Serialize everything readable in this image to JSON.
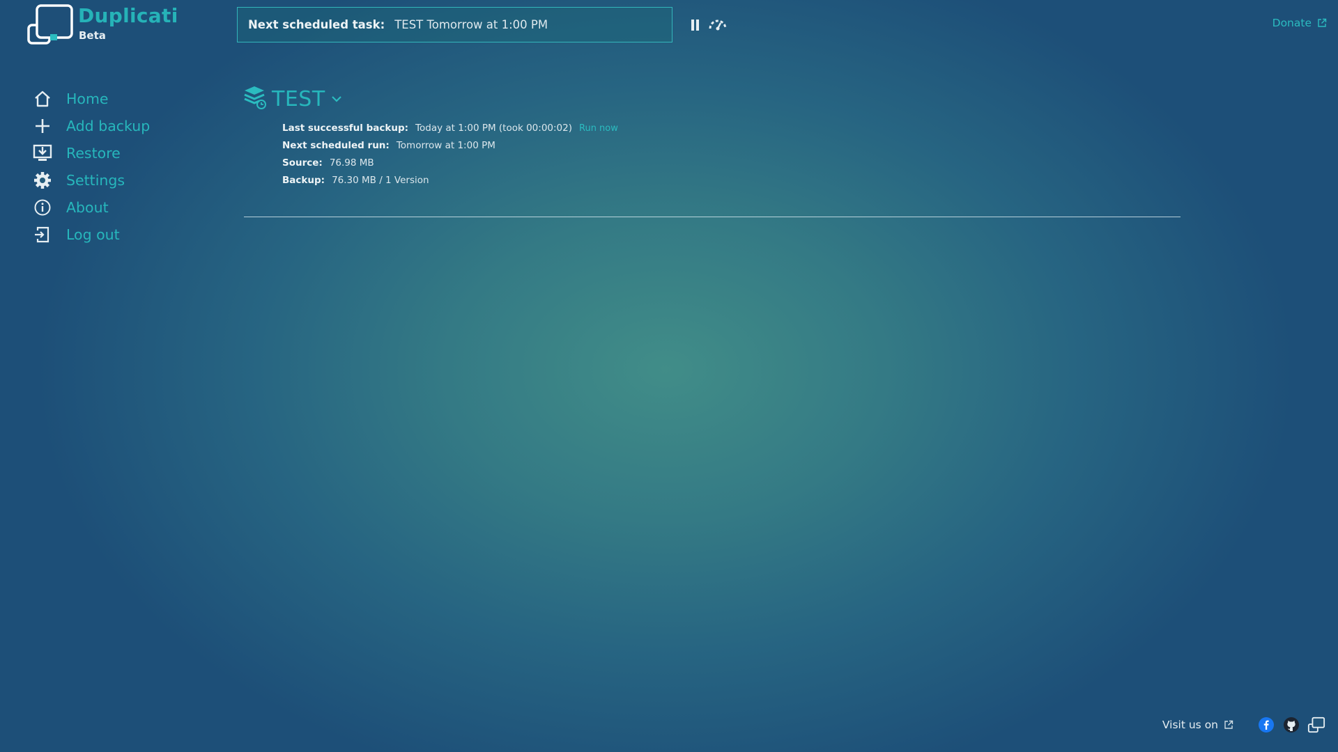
{
  "app": {
    "name": "Duplicati",
    "edition": "Beta"
  },
  "status": {
    "label": "Next scheduled task:",
    "value": "TEST Tomorrow at 1:00 PM"
  },
  "header": {
    "donate_label": "Donate"
  },
  "sidebar": {
    "items": [
      {
        "label": "Home",
        "icon": "home-icon"
      },
      {
        "label": "Add backup",
        "icon": "plus-icon"
      },
      {
        "label": "Restore",
        "icon": "restore-icon"
      },
      {
        "label": "Settings",
        "icon": "gear-icon"
      },
      {
        "label": "About",
        "icon": "info-icon"
      },
      {
        "label": "Log out",
        "icon": "logout-icon"
      }
    ]
  },
  "backup": {
    "name": "TEST",
    "last_backup_label": "Last successful backup:",
    "last_backup_value": "Today at 1:00 PM (took 00:00:02)",
    "run_now_label": "Run now",
    "next_run_label": "Next scheduled run:",
    "next_run_value": "Tomorrow at 1:00 PM",
    "source_label": "Source:",
    "source_value": "76.98 MB",
    "backup_label": "Backup:",
    "backup_value": "76.30 MB / 1 Version"
  },
  "footer": {
    "visit_label": "Visit us on"
  },
  "colors": {
    "accent": "#27b7bc",
    "background_center": "#418d88",
    "background_edge": "#1d4f78",
    "facebook": "#1877f2"
  }
}
